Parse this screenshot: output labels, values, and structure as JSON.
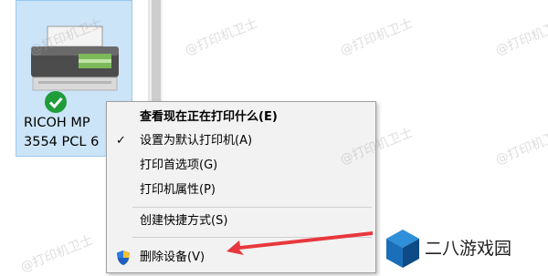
{
  "device": {
    "name_line1": "RICOH MP",
    "name_line2": "3554 PCL 6",
    "status_icon": "default-check-icon"
  },
  "context_menu": {
    "items": [
      {
        "label": "查看现在正在打印什么(E)",
        "bold": true
      },
      {
        "label": "设置为默认打印机(A)",
        "checked": true
      },
      {
        "label": "打印首选项(G)"
      },
      {
        "label": "打印机属性(P)"
      },
      {
        "label": "创建快捷方式(S)"
      },
      {
        "label": "删除设备(V)",
        "icon": "shield-icon"
      }
    ]
  },
  "watermark": {
    "text": "@打印机卫士"
  },
  "brand": {
    "name": "二八游戏园",
    "logo_icon": "cube-logo-icon"
  },
  "colors": {
    "selection_bg": "#cce4f7",
    "menu_bg": "#f2f2f2",
    "arrow": "#e8383d",
    "check_green": "#1f9d3a"
  }
}
